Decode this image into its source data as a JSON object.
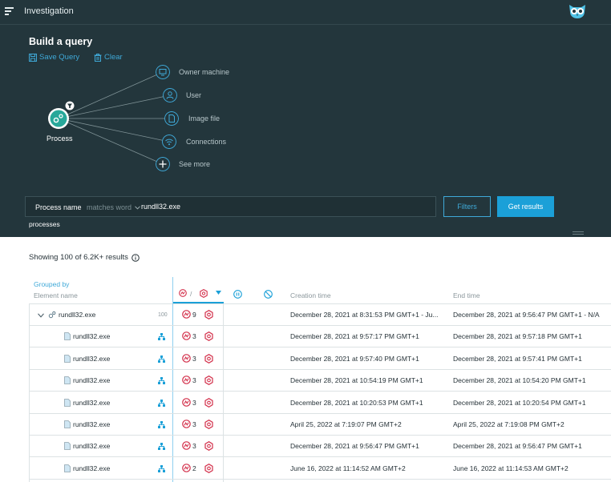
{
  "app": {
    "title": "Investigation"
  },
  "query": {
    "title": "Build a query",
    "save_label": "Save Query",
    "clear_label": "Clear",
    "root_node": "Process",
    "nodes": [
      {
        "label": "Owner machine",
        "icon": "monitor-icon"
      },
      {
        "label": "User",
        "icon": "user-icon"
      },
      {
        "label": "Image file",
        "icon": "file-icon"
      },
      {
        "label": "Connections",
        "icon": "wifi-icon"
      },
      {
        "label": "See more",
        "icon": "plus-icon"
      }
    ],
    "field": "Process name",
    "operator": "matches word",
    "value": "rundll32.exe",
    "filters_label": "Filters",
    "get_results_label": "Get results",
    "tag": "processes"
  },
  "results": {
    "showing": "Showing 100 of 6.2K+ results",
    "grouped_by": "Grouped by",
    "element_name_header": "Element name",
    "separator": "/",
    "creation_header": "Creation time",
    "end_header": "End time",
    "rows": [
      {
        "name": "rundll32.exe",
        "count": "100",
        "malops": "9",
        "creation": "December 28, 2021 at 8:31:53 PM GMT+1 - Ju...",
        "end": "December 28, 2021 at 9:56:47 PM GMT+1 - N/A"
      },
      {
        "name": "rundll32.exe",
        "malops": "3",
        "creation": "December 28, 2021 at 9:57:17 PM GMT+1",
        "end": "December 28, 2021 at 9:57:18 PM GMT+1"
      },
      {
        "name": "rundll32.exe",
        "malops": "3",
        "creation": "December 28, 2021 at 9:57:40 PM GMT+1",
        "end": "December 28, 2021 at 9:57:41 PM GMT+1"
      },
      {
        "name": "rundll32.exe",
        "malops": "3",
        "creation": "December 28, 2021 at 10:54:19 PM GMT+1",
        "end": "December 28, 2021 at 10:54:20 PM GMT+1"
      },
      {
        "name": "rundll32.exe",
        "malops": "3",
        "creation": "December 28, 2021 at 10:20:53 PM GMT+1",
        "end": "December 28, 2021 at 10:20:54 PM GMT+1"
      },
      {
        "name": "rundll32.exe",
        "malops": "3",
        "creation": "April 25, 2022 at 7:19:07 PM GMT+2",
        "end": "April 25, 2022 at 7:19:08 PM GMT+2"
      },
      {
        "name": "rundll32.exe",
        "malops": "3",
        "creation": "December 28, 2021 at 9:56:47 PM GMT+1",
        "end": "December 28, 2021 at 9:56:47 PM GMT+1"
      },
      {
        "name": "rundll32.exe",
        "malops": "2",
        "creation": "June 16, 2022 at 11:14:52 AM GMT+2",
        "end": "June 16, 2022 at 11:14:53 AM GMT+2"
      }
    ]
  },
  "colors": {
    "panel_bg": "#23363c",
    "accent": "#1ba0d8",
    "link": "#3fa9d8",
    "malop_red": "#d32f4a",
    "node_teal": "#27a89a"
  }
}
